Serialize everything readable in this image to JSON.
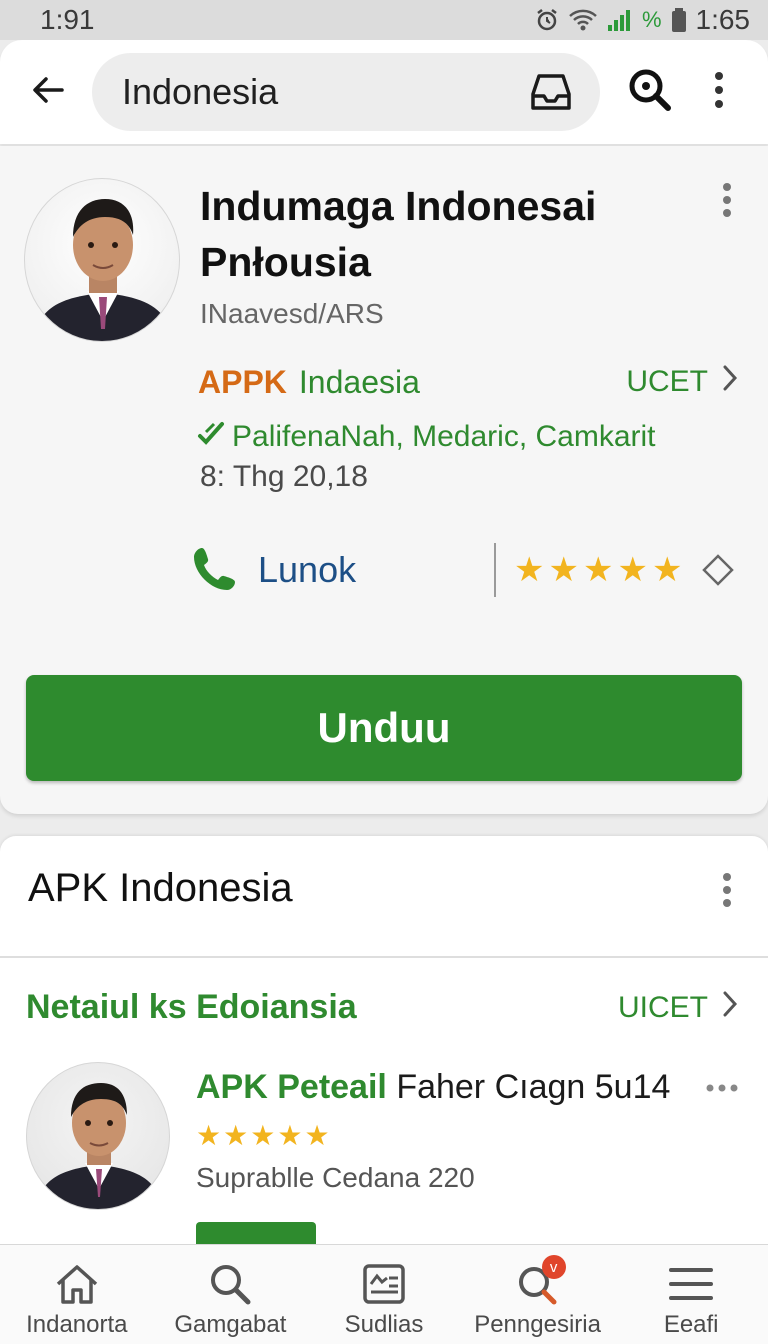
{
  "status_bar": {
    "time": "1:91",
    "battery_percent": "%",
    "clock_right": "1:65",
    "icons": [
      "alarm-icon",
      "wifi-icon",
      "signal-icon",
      "battery-icon"
    ]
  },
  "app_bar": {
    "back_icon": "arrow-left-icon",
    "search_query": "Indonesia",
    "inbox_icon": "inbox-icon",
    "search_icon": "search-icon",
    "more_icon": "more-vertical-icon"
  },
  "app_card": {
    "title": "Indumaga Indonesai Pnłousia",
    "developer": "INaavesd/ARS",
    "apk_badge": "APPK",
    "apk_name": "Indaesia",
    "ucet_label": "UCET",
    "categories": "PalifenaNah, Medaric, Camkarit",
    "date": "8: Thg 20,18",
    "call_label": "Lunok",
    "rating_stars": 5,
    "download_label": "Unduu"
  },
  "section": {
    "title": "APK Indonesia",
    "subheading": "Netaiul ks Edoiansia",
    "subheading_link": "UICET",
    "item": {
      "title_green": "APK Peteail",
      "title_rest": "Faher Cıagn 5u14",
      "rating_stars": 5,
      "subtitle": "Suprablle Cedana 220"
    }
  },
  "bottom_nav": [
    {
      "label": "Indanorta",
      "icon": "home-icon"
    },
    {
      "label": "Gamgabat",
      "icon": "search-icon"
    },
    {
      "label": "Sudlias",
      "icon": "updates-icon"
    },
    {
      "label": "Penngesiria",
      "icon": "search-notification-icon",
      "badge": "v"
    },
    {
      "label": "Eeafi",
      "icon": "menu-icon"
    }
  ],
  "colors": {
    "accent_green": "#2e8b2e",
    "apk_orange": "#d56a16",
    "star_gold": "#f2b41f",
    "call_blue": "#1d4f86"
  }
}
